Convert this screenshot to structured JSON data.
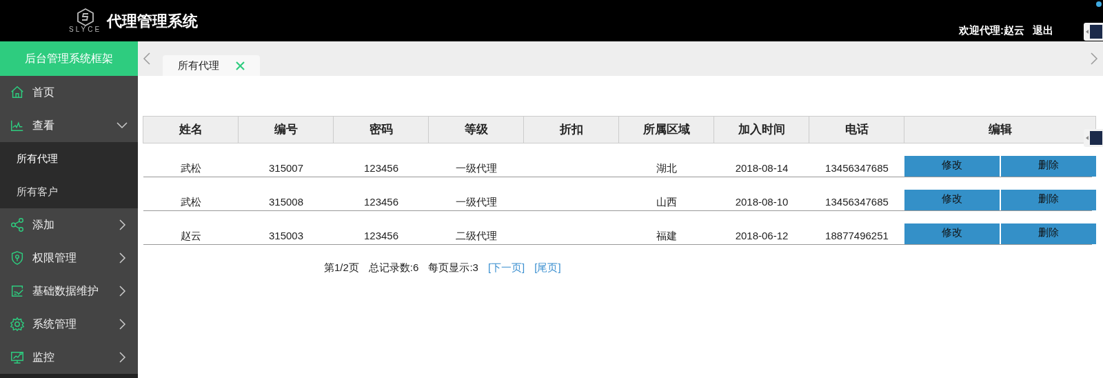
{
  "header": {
    "logo_text": "SLYCE",
    "title": "代理管理系统",
    "welcome": "欢迎代理:赵云",
    "logout": "退出"
  },
  "sidebar": {
    "title": "后台管理系统框架",
    "items": [
      {
        "label": "首页",
        "has_children": false
      },
      {
        "label": "查看",
        "expanded": true,
        "has_children": true,
        "children": [
          {
            "label": "所有代理",
            "selected": true
          },
          {
            "label": "所有客户",
            "selected": false
          }
        ]
      },
      {
        "label": "添加",
        "expanded": false,
        "has_children": true
      },
      {
        "label": "权限管理",
        "expanded": false,
        "has_children": true
      },
      {
        "label": "基础数据维护",
        "expanded": false,
        "has_children": true
      },
      {
        "label": "系统管理",
        "expanded": false,
        "has_children": true
      },
      {
        "label": "监控",
        "expanded": false,
        "has_children": true
      }
    ]
  },
  "tabs": [
    {
      "label": "所有代理",
      "selected": true
    }
  ],
  "table": {
    "columns": [
      "姓名",
      "编号",
      "密码",
      "等级",
      "折扣",
      "所属区域",
      "加入时间",
      "电话",
      "编辑"
    ],
    "rows": [
      {
        "cells": [
          "武松",
          "315007",
          "123456",
          "一级代理",
          "",
          "湖北",
          "2018-08-14",
          "13456347685"
        ],
        "actions": [
          "修改",
          "删除"
        ]
      },
      {
        "cells": [
          "武松",
          "315008",
          "123456",
          "一级代理",
          "",
          "山西",
          "2018-08-10",
          "13456347685"
        ],
        "actions": [
          "修改",
          "删除"
        ]
      },
      {
        "cells": [
          "赵云",
          "315003",
          "123456",
          "二级代理",
          "",
          "福建",
          "2018-06-12",
          "18877496251"
        ],
        "actions": [
          "修改",
          "删除"
        ]
      }
    ]
  },
  "pagination": {
    "info": [
      "第1/2页",
      "总记录数:6",
      "每页显示:3"
    ],
    "links": [
      "[下一页]",
      "[尾页]"
    ]
  }
}
